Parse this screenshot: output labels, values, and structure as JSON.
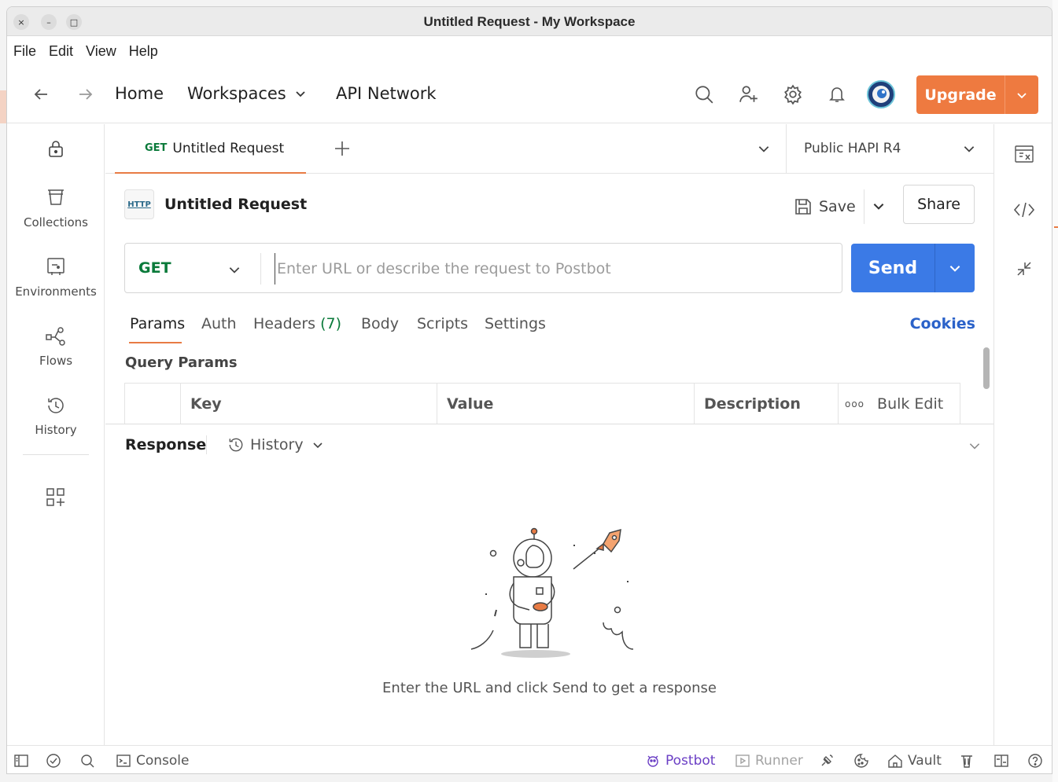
{
  "window": {
    "title": "Untitled Request - My Workspace",
    "controls": {
      "close": "×",
      "minimize": "–",
      "maximize": "□"
    }
  },
  "menu": [
    "File",
    "Edit",
    "View",
    "Help"
  ],
  "topnav": {
    "home": "Home",
    "workspaces": "Workspaces",
    "api_network": "API Network",
    "upgrade": "Upgrade"
  },
  "sidebar": {
    "items": [
      {
        "label": "Collections",
        "icon": "trash-can-icon"
      },
      {
        "label": "Environments",
        "icon": "environment-icon"
      },
      {
        "label": "Flows",
        "icon": "flows-icon"
      },
      {
        "label": "History",
        "icon": "history-icon"
      }
    ]
  },
  "tabs": {
    "active": {
      "method": "GET",
      "name": "Untitled Request"
    },
    "environment": "Public HAPI R4"
  },
  "request": {
    "title": "Untitled Request",
    "badge": "HTTP",
    "save": "Save",
    "share": "Share",
    "method": "GET",
    "url_placeholder": "Enter URL or describe the request to Postbot",
    "url_value": "",
    "send": "Send"
  },
  "subtabs": {
    "params": "Params",
    "auth": "Auth",
    "headers": "Headers",
    "headers_count": "(7)",
    "body": "Body",
    "scripts": "Scripts",
    "settings": "Settings",
    "cookies": "Cookies"
  },
  "query_params": {
    "title": "Query Params",
    "columns": {
      "key": "Key",
      "value": "Value",
      "description": "Description"
    },
    "bulk_edit": "Bulk Edit",
    "dots": "ooo"
  },
  "response": {
    "title": "Response",
    "history": "History",
    "empty_message": "Enter the URL and click Send to get a response"
  },
  "statusbar": {
    "console": "Console",
    "postbot": "Postbot",
    "runner": "Runner",
    "vault": "Vault"
  },
  "colors": {
    "accent_orange": "#ee7a40",
    "send_blue": "#3b7ae6",
    "get_green": "#0a7a3a",
    "cookies_blue": "#2b62c9",
    "postbot_purple": "#6b3fc5"
  }
}
